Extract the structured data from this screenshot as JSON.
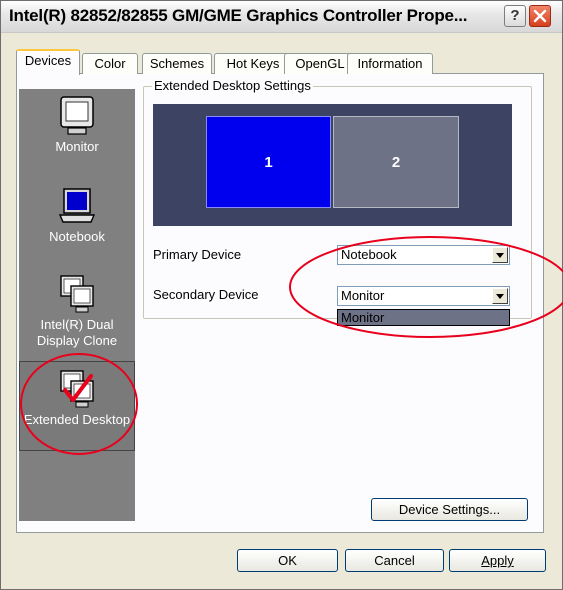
{
  "window": {
    "title": "Intel(R) 82852/82855 GM/GME Graphics Controller Prope..."
  },
  "titlebar": {
    "help_label": "?",
    "close_icon": "close-icon"
  },
  "tabs": [
    {
      "label": "Devices"
    },
    {
      "label": "Color"
    },
    {
      "label": "Schemes"
    },
    {
      "label": "Hot Keys"
    },
    {
      "label": "OpenGL"
    },
    {
      "label": "Information"
    }
  ],
  "devices": [
    {
      "label": "Monitor",
      "icon": "monitor-icon"
    },
    {
      "label": "Notebook",
      "icon": "notebook-icon"
    },
    {
      "label": "Intel(R) Dual Display Clone",
      "icon": "dual-display-icon"
    },
    {
      "label": "Extended Desktop",
      "icon": "extended-desktop-icon"
    }
  ],
  "extended": {
    "group_title": "Extended Desktop Settings",
    "display1": "1",
    "display2": "2",
    "primary_label": "Primary Device",
    "primary_value": "Notebook",
    "secondary_label": "Secondary Device",
    "secondary_value": "Monitor",
    "dropdown_option": "Monitor"
  },
  "buttons": {
    "device_settings": "Device Settings...",
    "ok": "OK",
    "cancel": "Cancel",
    "apply": "Apply"
  },
  "colors": {
    "primary_display": "#0000ee",
    "secondary_display": "#6e7286",
    "annotation": "#e8001c"
  }
}
